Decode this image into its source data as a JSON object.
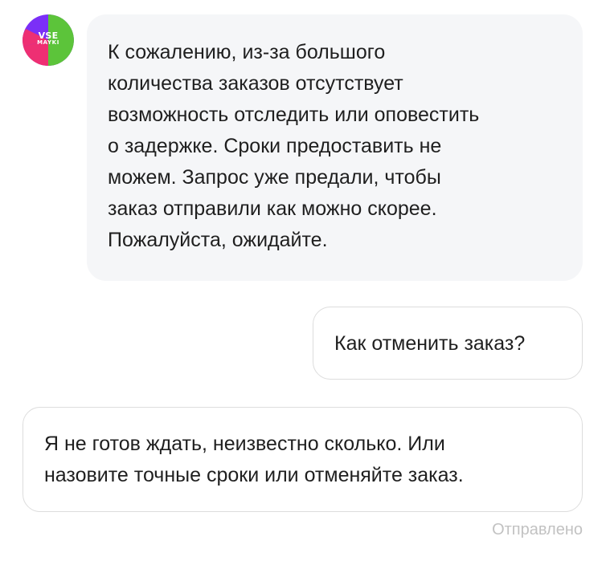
{
  "chat": {
    "avatar": {
      "icon": "vsemayki-logo-icon",
      "logo_text_1": "VSE",
      "logo_text_2": "MAYKI"
    },
    "incoming_message": {
      "lines": [
        "К сожалению, из-за большого",
        "количества заказов отсутствует",
        "возможность отследить или оповестить",
        "о задержке. Сроки предоставить не",
        "можем. Запрос уже предали, чтобы",
        "заказ отправили как можно скорее.",
        "Пожалуйста, ожидайте."
      ]
    },
    "outgoing_message_1": {
      "text": "Как отменить заказ?"
    },
    "outgoing_message_2": {
      "lines": [
        "Я не готов ждать, неизвестно сколько. Или",
        "назовите точные сроки или отменяйте заказ."
      ]
    },
    "status": "Отправлено"
  },
  "colors": {
    "incoming_bubble_bg": "#f5f6f8",
    "outgoing_bubble_border": "#dddddd",
    "status_text": "#c2c2c2",
    "logo_purple": "#7b2ff7",
    "logo_green": "#5cc43a",
    "logo_pink": "#ee2f73"
  }
}
